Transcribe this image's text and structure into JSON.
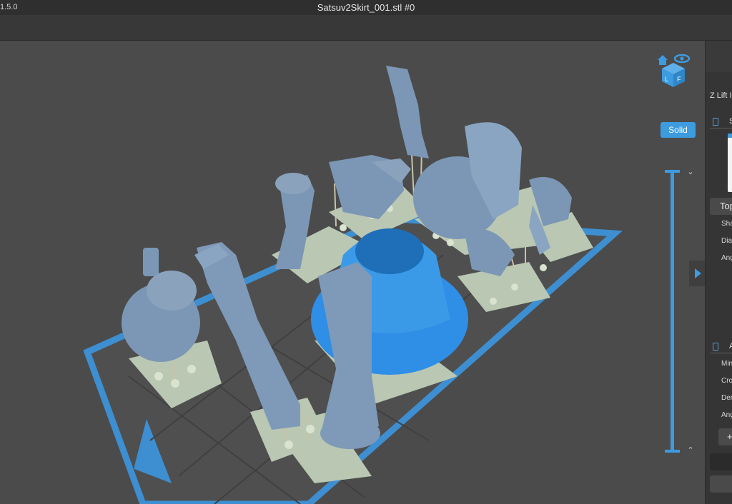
{
  "app": {
    "version": "1.5.0",
    "window_title": "Satsuv2Skirt_001.stl #0"
  },
  "viewport": {
    "render_mode_label": "Solid",
    "view_cube_icon": "view-cube-icon",
    "home_icon": "home-icon",
    "eye_icon": "eye-icon",
    "z_slider_up_icon": "chevron-up-icon",
    "z_slider_down_icon": "chevron-down-icon",
    "collapse_panel_icon": "play-triangle-icon",
    "colors": {
      "background": "#4b4b4b",
      "build_plate_border": "#3d8fd1",
      "selected_model": "#2f8ee6",
      "model": "#7b97b5",
      "support_raft": "#b9c7b3",
      "accent": "#3d9be0"
    }
  },
  "sidebar": {
    "z_lift_label": "Z Lift I",
    "section1_header": "S",
    "top_button": "Top",
    "row1": "Sha",
    "row2": "Dia",
    "row3": "Ang",
    "section2_header": "A",
    "row4": "Min",
    "row5": "Cro",
    "row6": "Den",
    "row7": "Ang",
    "plus_button": "+"
  }
}
